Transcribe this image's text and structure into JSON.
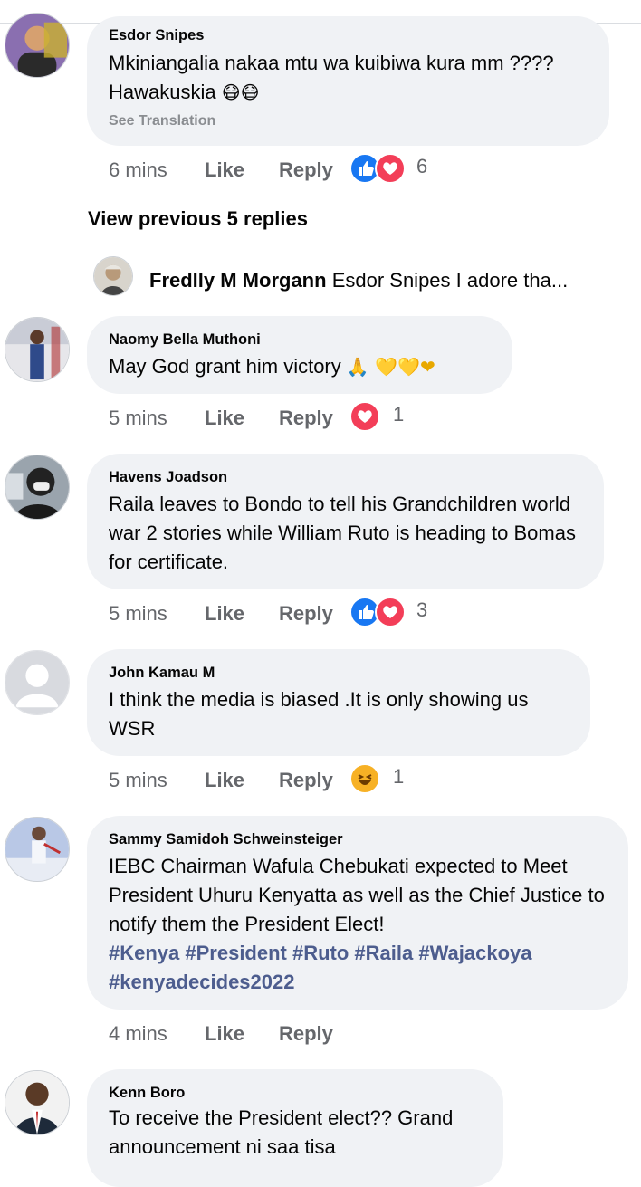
{
  "view_previous": "View previous 5 replies",
  "reply_preview": {
    "name": "Fredlly  M Morgann",
    "text": "Esdor Snipes I adore tha..."
  },
  "comments": [
    {
      "name": "Esdor Snipes",
      "text_line1": "Mkiniangalia nakaa mtu wa kuibiwa kura mm ????",
      "text_line2": "Hawakuskia",
      "emoji": "😷😷",
      "see_translation": "See Translation",
      "time": "6 mins",
      "like": "Like",
      "reply": "Reply",
      "reaction_icons": [
        "like-icon",
        "love-icon"
      ],
      "reaction_count": "6"
    },
    {
      "name": "Naomy Bella Muthoni",
      "text": "May God grant him victory",
      "emoji": "🙏 💛💛❤",
      "time": "5 mins",
      "like": "Like",
      "reply": "Reply",
      "reaction_icons": [
        "love-icon"
      ],
      "reaction_count": "1"
    },
    {
      "name": "Havens Joadson",
      "text": "Raila leaves to Bondo to tell his Grandchildren world war 2 stories while William Ruto is heading to Bomas for certificate.",
      "time": "5 mins",
      "like": "Like",
      "reply": "Reply",
      "reaction_icons": [
        "like-icon",
        "love-icon"
      ],
      "reaction_count": "3"
    },
    {
      "name": "John Kamau M",
      "text": "I think the media is biased .It is only showing us WSR",
      "time": "5 mins",
      "like": "Like",
      "reply": "Reply",
      "reaction_icons": [
        "haha-icon"
      ],
      "reaction_count": "1"
    },
    {
      "name": "Sammy Samidoh Schweinsteiger",
      "text": "IEBC Chairman Wafula Chebukati expected to Meet President Uhuru Kenyatta as well as the Chief Justice to notify them the President Elect!",
      "hashtags_line1": "#Kenya #President #Ruto #Raila #Wajackoya",
      "hashtags_line2": "#kenyadecides2022",
      "time": "4 mins",
      "like": "Like",
      "reply": "Reply"
    },
    {
      "name": "Kenn Boro",
      "text": "To receive the President elect?? Grand announcement ni saa tisa"
    }
  ],
  "colors": {
    "bubble": "#f0f2f5",
    "meta": "#65676b",
    "like_blue": "#1877f2",
    "love_red": "#f33e58",
    "haha_yellow": "#f7b125",
    "hashtag": "#4d5d8e"
  }
}
